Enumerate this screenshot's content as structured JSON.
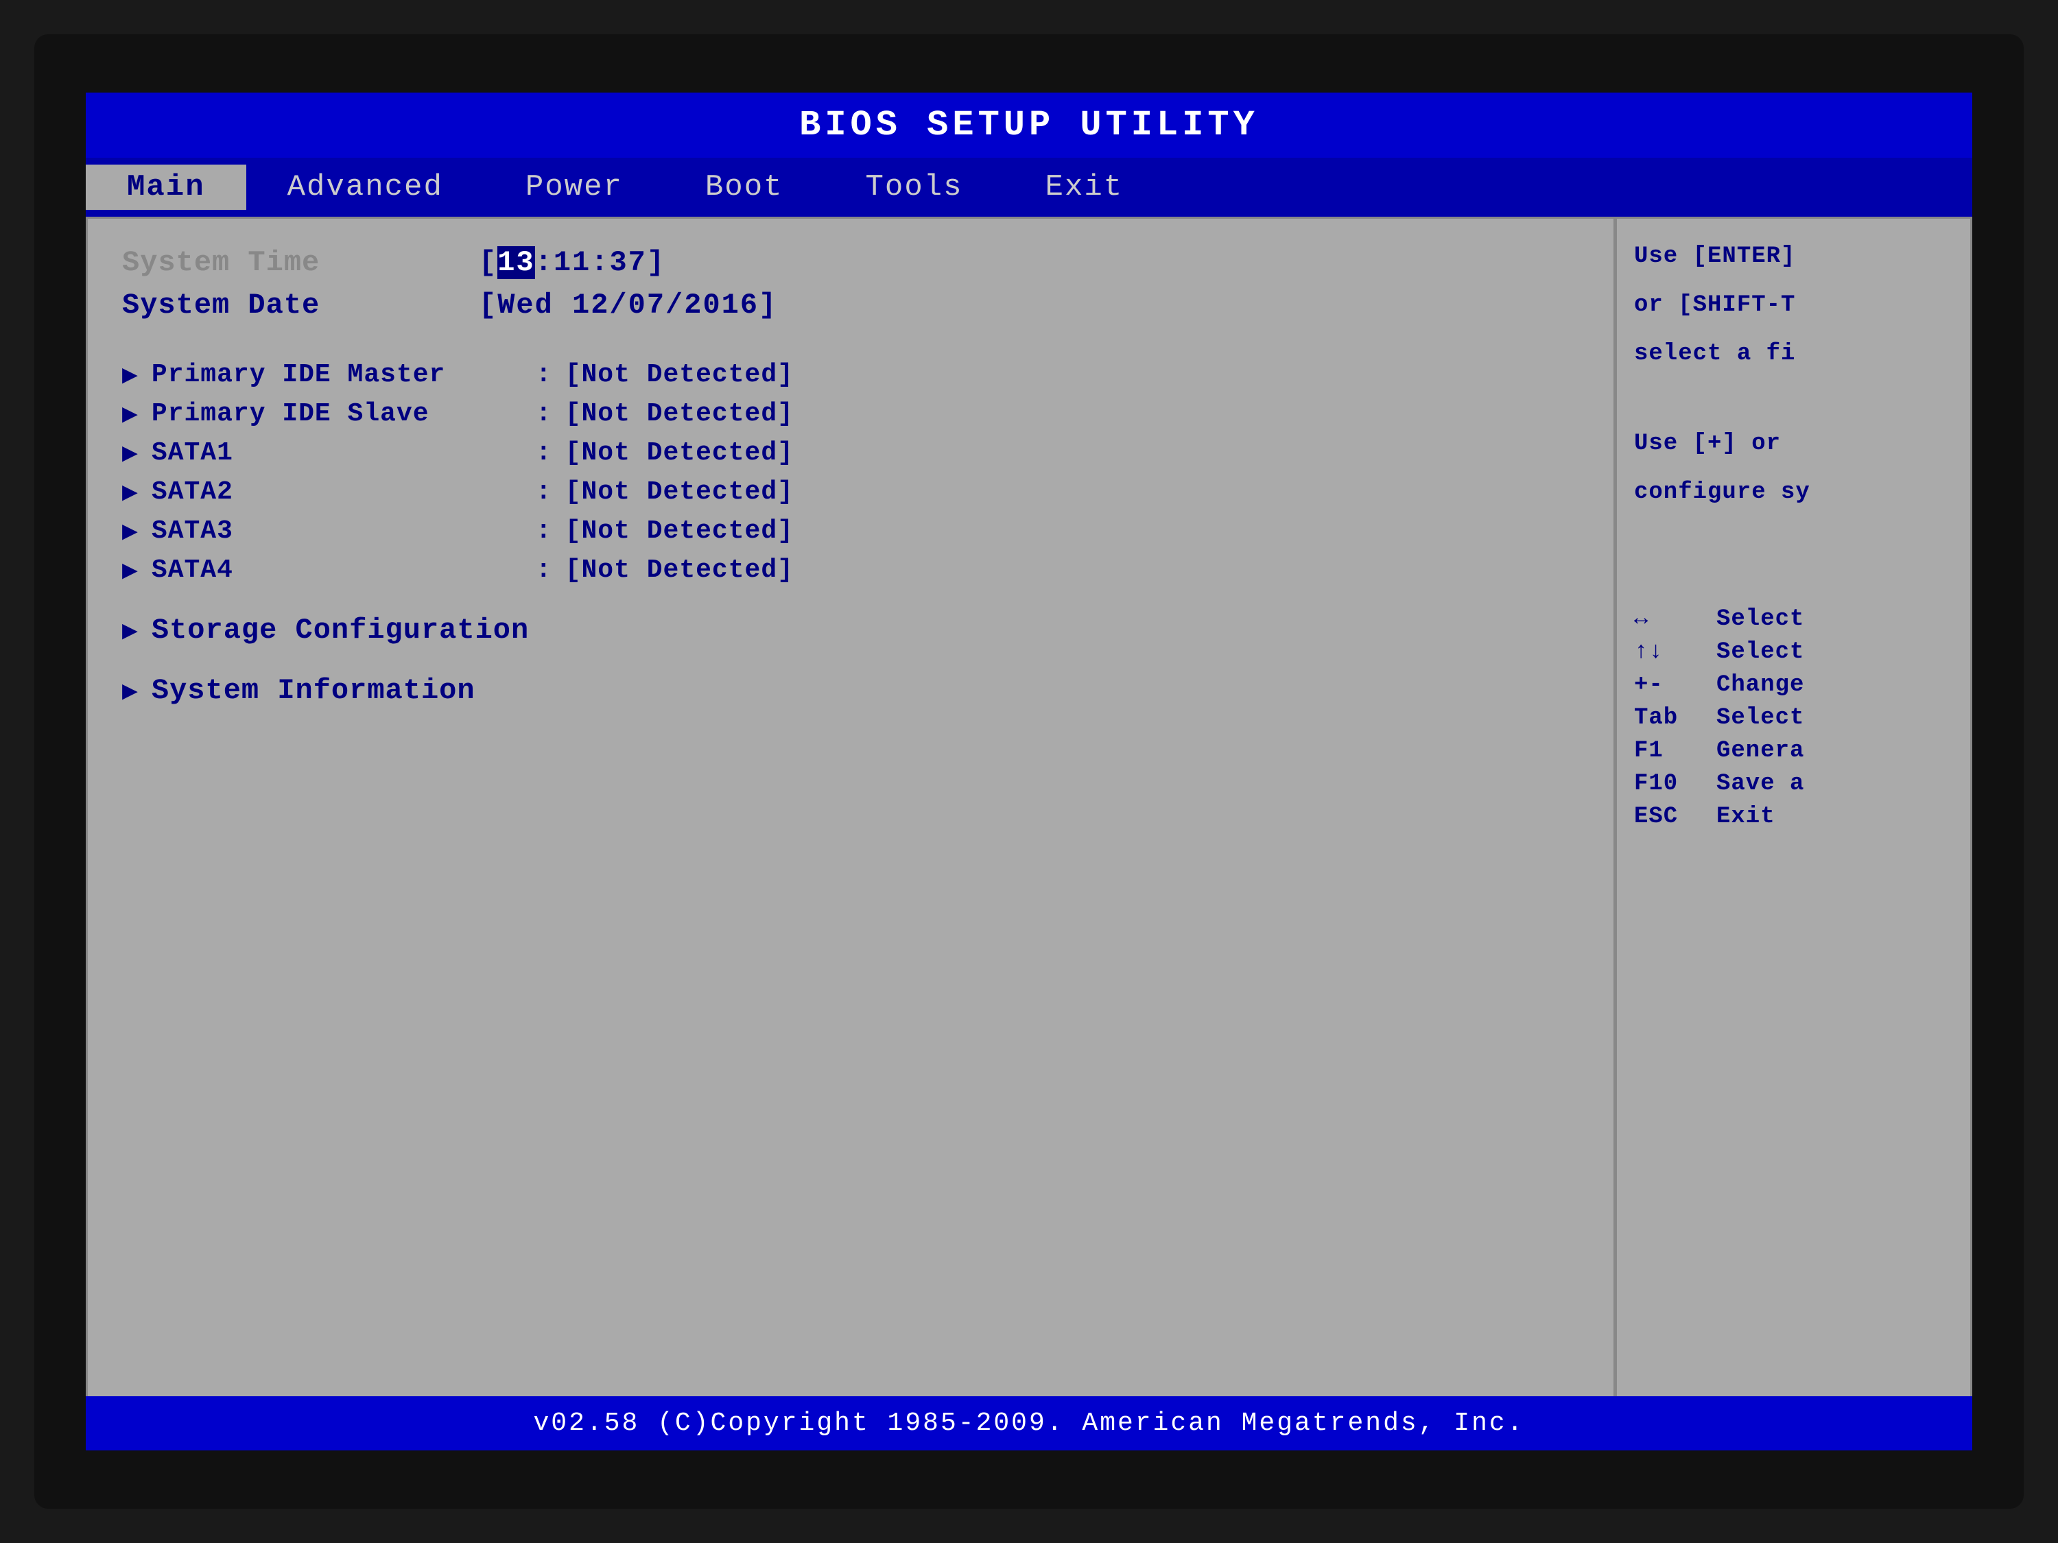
{
  "title_bar": {
    "text": "BIOS  SETUP  UTILITY"
  },
  "nav": {
    "items": [
      {
        "label": "Main",
        "active": true
      },
      {
        "label": "Advanced",
        "active": false
      },
      {
        "label": "Power",
        "active": false
      },
      {
        "label": "Boot",
        "active": false
      },
      {
        "label": "Tools",
        "active": false
      },
      {
        "label": "Exit",
        "active": false
      }
    ]
  },
  "main": {
    "system_time_label": "System Time",
    "system_time_value_prefix": "[",
    "system_time_highlight": "13",
    "system_time_value_suffix": ":11:37]",
    "system_date_label": "System Date",
    "system_date_value": "[Wed 12/07/2016]",
    "devices": [
      {
        "label": "Primary IDE Master",
        "value": "[Not Detected]"
      },
      {
        "label": "Primary IDE Slave",
        "value": "[Not Detected]"
      },
      {
        "label": "SATA1",
        "value": "[Not Detected]"
      },
      {
        "label": "SATA2",
        "value": "[Not Detected]"
      },
      {
        "label": "SATA3",
        "value": "[Not Detected]"
      },
      {
        "label": "SATA4",
        "value": "[Not Detected]"
      }
    ],
    "submenus": [
      {
        "label": "Storage Configuration"
      },
      {
        "label": "System Information"
      }
    ]
  },
  "help": {
    "line1": "Use [ENTER]",
    "line2": "or [SHIFT-T",
    "line3": "select a fi",
    "line4": "Use [+] or",
    "line5": "configure sy",
    "keys": [
      {
        "key": "↔",
        "desc": "Select"
      },
      {
        "key": "↑↓",
        "desc": "Select"
      },
      {
        "key": "+-",
        "desc": "Change"
      },
      {
        "key": "Tab",
        "desc": "Select"
      },
      {
        "key": "F1",
        "desc": "Genera"
      },
      {
        "key": "F10",
        "desc": "Save a"
      },
      {
        "key": "ESC",
        "desc": "Exit"
      }
    ]
  },
  "footer": {
    "text": "v02.58  (C)Copyright 1985-2009. American Megatrends, Inc."
  }
}
